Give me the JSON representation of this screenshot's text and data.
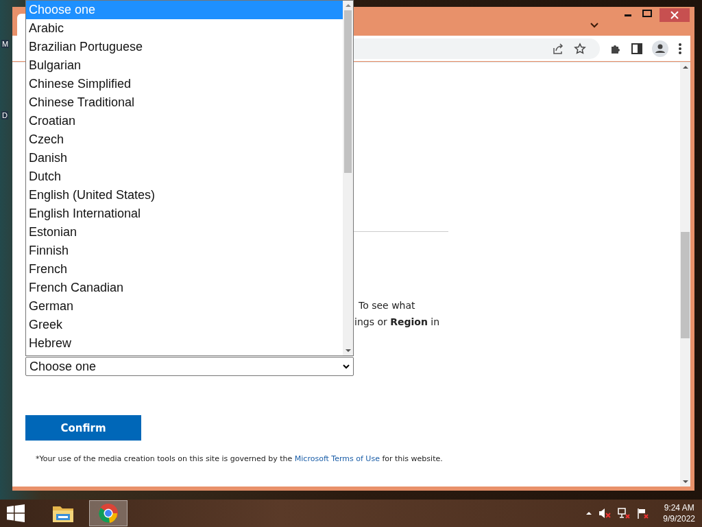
{
  "desktop": {
    "icon_labels": [
      "M",
      "D"
    ]
  },
  "browser": {
    "page": {
      "text_lines": [
        "To see what",
        "ings or **Region** in"
      ],
      "select": {
        "value": "Choose one"
      },
      "dropdown": {
        "options": [
          {
            "label": "Choose one",
            "selected": true
          },
          {
            "label": "Arabic",
            "selected": false
          },
          {
            "label": "Brazilian Portuguese",
            "selected": false
          },
          {
            "label": "Bulgarian",
            "selected": false
          },
          {
            "label": "Chinese Simplified",
            "selected": false
          },
          {
            "label": "Chinese Traditional",
            "selected": false
          },
          {
            "label": "Croatian",
            "selected": false
          },
          {
            "label": "Czech",
            "selected": false
          },
          {
            "label": "Danish",
            "selected": false
          },
          {
            "label": "Dutch",
            "selected": false
          },
          {
            "label": "English (United States)",
            "selected": false
          },
          {
            "label": "English International",
            "selected": false
          },
          {
            "label": "Estonian",
            "selected": false
          },
          {
            "label": "Finnish",
            "selected": false
          },
          {
            "label": "French",
            "selected": false
          },
          {
            "label": "French Canadian",
            "selected": false
          },
          {
            "label": "German",
            "selected": false
          },
          {
            "label": "Greek",
            "selected": false
          },
          {
            "label": "Hebrew",
            "selected": false
          }
        ]
      },
      "confirm_button": "Confirm",
      "footer": {
        "before": "*Your use of the media creation tools on this site is governed by the",
        "link": "Microsoft Terms of Use",
        "after": "for this website."
      }
    }
  },
  "taskbar": {
    "apps": [
      {
        "kind": "explorer",
        "selected": false
      },
      {
        "kind": "chrome",
        "selected": true
      }
    ],
    "tray": {
      "volume_muted": true
    },
    "clock": {
      "time": "9:24 AM",
      "date": "9/9/2022"
    }
  }
}
